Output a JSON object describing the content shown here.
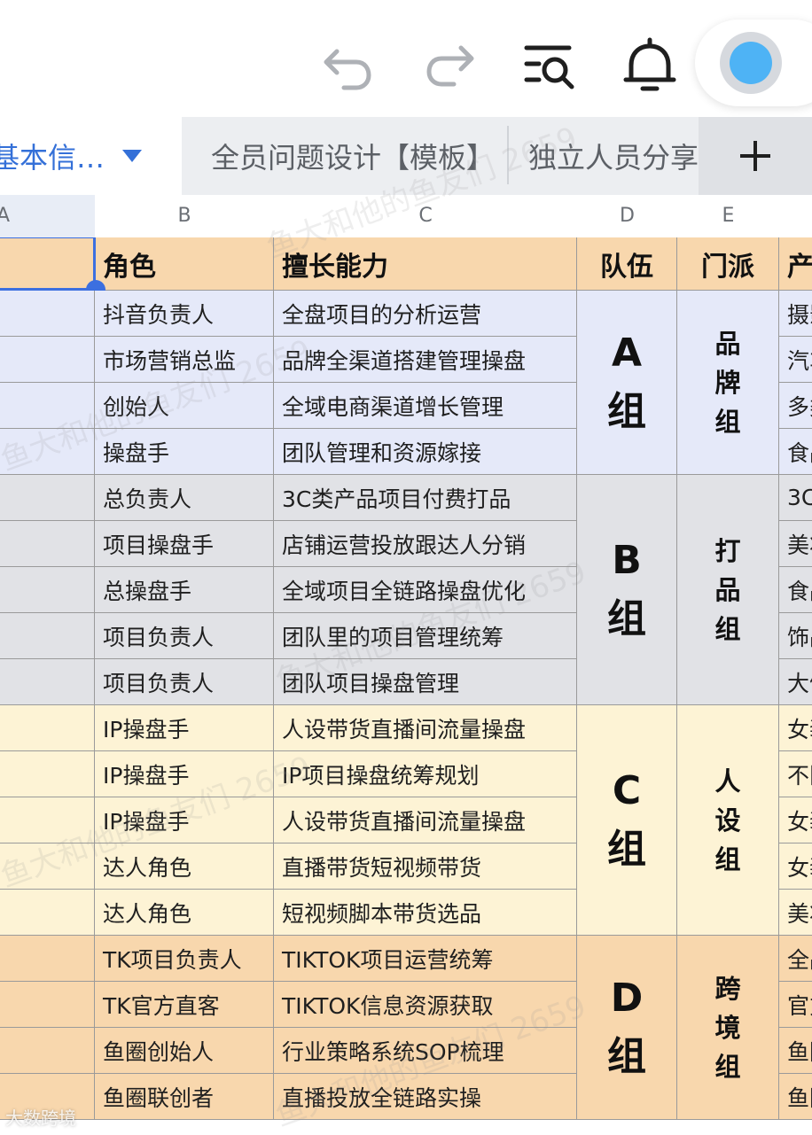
{
  "toolbar": {
    "icons": [
      "undo-icon",
      "redo-icon",
      "search-list-icon",
      "bell-icon"
    ],
    "avatar_color": "#4eb3f5"
  },
  "tabs": [
    {
      "label": "基本信…",
      "active": true
    },
    {
      "label": "全员问题设计【模板】",
      "active": false
    },
    {
      "label": "独立人员分享",
      "active": false
    }
  ],
  "add_tab_symbol": "+",
  "columns": [
    "A",
    "B",
    "C",
    "D",
    "E"
  ],
  "headers": {
    "role": "角色",
    "skill": "擅长能力",
    "team": "队伍",
    "sect": "门派",
    "product": "产"
  },
  "colors": {
    "header": "#f8d7ad",
    "groupA": "#e5e9f9",
    "groupB": "#e1e2e6",
    "groupC": "#fdf3d5",
    "groupD": "#f8d7ad",
    "selection": "#3c6fe0",
    "tab_active": "#3470d8"
  },
  "groups": [
    {
      "team": "A组",
      "sect": "品牌组",
      "rows": [
        {
          "role": "抖音负责人",
          "skill": "全盘项目的分析运营",
          "product": "摄影"
        },
        {
          "role": "市场营销总监",
          "skill": "品牌全渠道搭建管理操盘",
          "product": "汽车"
        },
        {
          "role": "创始人",
          "skill": "全域电商渠道增长管理",
          "product": "多类"
        },
        {
          "role": "操盘手",
          "skill": "团队管理和资源嫁接",
          "product": "食品"
        }
      ]
    },
    {
      "team": "B组",
      "sect": "打品组",
      "rows": [
        {
          "role": "总负责人",
          "skill": "3C类产品项目付费打品",
          "product": "3C"
        },
        {
          "role": "项目操盘手",
          "skill": "店铺运营投放跟达人分销",
          "product": "美妆"
        },
        {
          "role": "总操盘手",
          "skill": "全域项目全链路操盘优化",
          "product": "食品"
        },
        {
          "role": "项目负责人",
          "skill": "团队里的项目管理统筹",
          "product": "饰品"
        },
        {
          "role": "项目负责人",
          "skill": "团队项目操盘管理",
          "product": "大健"
        }
      ]
    },
    {
      "team": "C组",
      "sect": "人设组",
      "rows": [
        {
          "role": "IP操盘手",
          "skill": "人设带货直播间流量操盘",
          "product": "女装"
        },
        {
          "role": "IP操盘手",
          "skill": "IP项目操盘统筹规划",
          "product": "不限"
        },
        {
          "role": "IP操盘手",
          "skill": "人设带货直播间流量操盘",
          "product": "女装"
        },
        {
          "role": "达人角色",
          "skill": "直播带货短视频带货",
          "product": "女装"
        },
        {
          "role": "达人角色",
          "skill": "短视频脚本带货选品",
          "product": "美妆"
        }
      ]
    },
    {
      "team": "D组",
      "sect": "跨境组",
      "rows": [
        {
          "role": "TK项目负责人",
          "skill": "TIKTOK项目运营统筹",
          "product": "全品"
        },
        {
          "role": "TK官方直客",
          "skill": "TIKTOK信息资源获取",
          "product": "官方"
        },
        {
          "role": "鱼圈创始人",
          "skill": "行业策略系统SOP梳理",
          "product": "鱼圈"
        },
        {
          "role": "鱼圈联创者",
          "skill": "直播投放全链路实操",
          "product": "鱼圈"
        }
      ]
    }
  ],
  "watermark": "鱼大和他的鱼友们 2659",
  "corner_watermark": "大数跨境"
}
